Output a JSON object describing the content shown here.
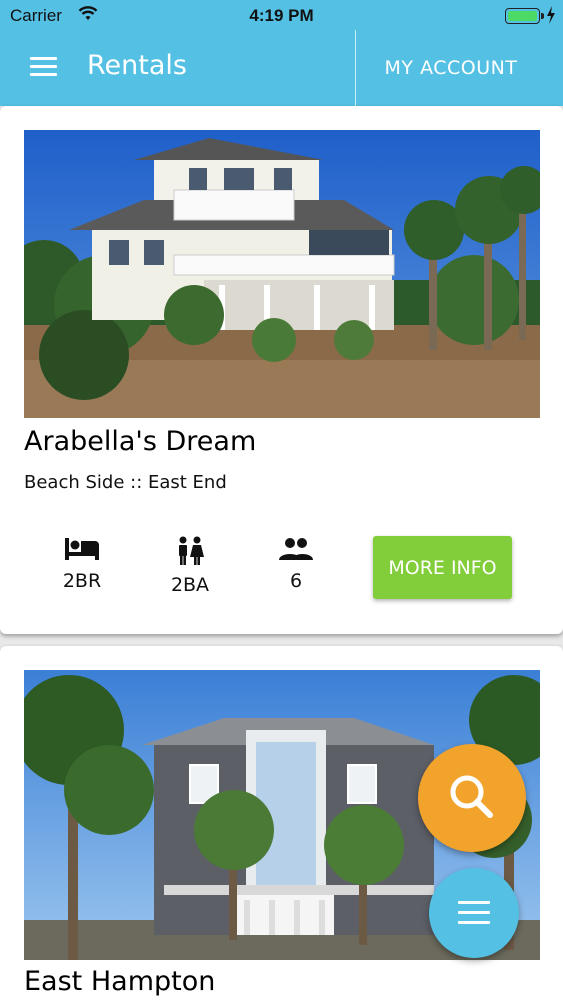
{
  "status_bar": {
    "carrier": "Carrier",
    "time": "4:19 PM",
    "battery_level": 1.0
  },
  "app_bar": {
    "title": "Rentals",
    "account_label": "MY ACCOUNT",
    "menu_icon": "hamburger-icon"
  },
  "rentals": [
    {
      "name": "Arabella's Dream",
      "location": "Beach Side :: East End",
      "bedrooms": "2BR",
      "bathrooms": "2BA",
      "sleeps": "6",
      "more_label": "MORE INFO"
    },
    {
      "name": "East Hampton"
    }
  ],
  "fabs": {
    "search_icon": "search-icon",
    "menu_icon": "menu-icon"
  },
  "colors": {
    "primary": "#54c0e4",
    "accent_button": "#82cd3a",
    "fab_search": "#f2a32c"
  }
}
